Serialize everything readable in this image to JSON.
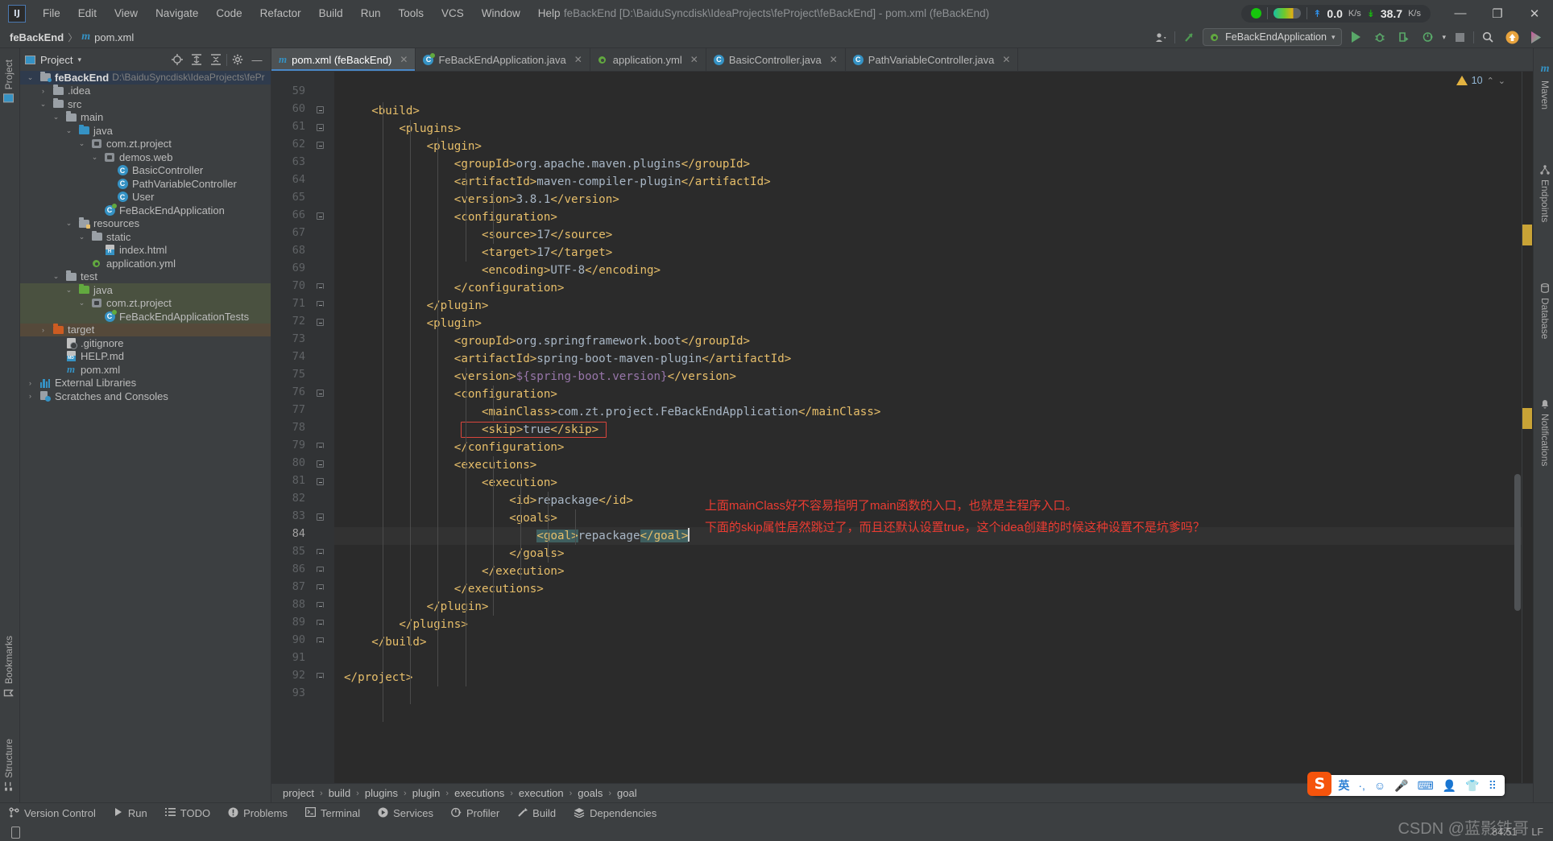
{
  "window": {
    "title": "feBackEnd [D:\\BaiduSyncdisk\\IdeaProjects\\feProject\\feBackEnd] - pom.xml (feBackEnd)",
    "logo": "IJ",
    "minimize": "—",
    "maximize": "❐",
    "close": "✕"
  },
  "menubar": {
    "items": [
      "File",
      "Edit",
      "View",
      "Navigate",
      "Code",
      "Refactor",
      "Build",
      "Run",
      "Tools",
      "VCS",
      "Window",
      "Help"
    ]
  },
  "network": {
    "upload_value": "0.0",
    "upload_unit": "K/s",
    "download_value": "38.7",
    "download_unit": "K/s",
    "up_arrow": "↟",
    "down_arrow": "↡"
  },
  "navbar": {
    "project": "feBackEnd",
    "separator": "〉",
    "file": "pom.xml",
    "run_configuration": "FeBackEndApplication",
    "chevron": "▾"
  },
  "project_panel": {
    "title": "Project",
    "tree": [
      {
        "depth": 0,
        "arrow": "⌄",
        "icon": "module-folder",
        "label": "feBackEnd",
        "bold": true,
        "path": "D:\\BaiduSyncdisk\\IdeaProjects\\fePr",
        "state": "root-selected"
      },
      {
        "depth": 1,
        "arrow": "›",
        "icon": "folder",
        "label": ".idea"
      },
      {
        "depth": 1,
        "arrow": "⌄",
        "icon": "folder",
        "label": "src"
      },
      {
        "depth": 2,
        "arrow": "⌄",
        "icon": "folder",
        "label": "main"
      },
      {
        "depth": 3,
        "arrow": "⌄",
        "icon": "folder-blue",
        "label": "java"
      },
      {
        "depth": 4,
        "arrow": "⌄",
        "icon": "package",
        "label": "com.zt.project"
      },
      {
        "depth": 5,
        "arrow": "⌄",
        "icon": "package",
        "label": "demos.web"
      },
      {
        "depth": 6,
        "arrow": "",
        "icon": "class",
        "label": "BasicController"
      },
      {
        "depth": 6,
        "arrow": "",
        "icon": "class",
        "label": "PathVariableController"
      },
      {
        "depth": 6,
        "arrow": "",
        "icon": "class",
        "label": "User"
      },
      {
        "depth": 5,
        "arrow": "",
        "icon": "spring-class",
        "label": "FeBackEndApplication"
      },
      {
        "depth": 3,
        "arrow": "⌄",
        "icon": "folder-res",
        "label": "resources"
      },
      {
        "depth": 4,
        "arrow": "⌄",
        "icon": "folder",
        "label": "static"
      },
      {
        "depth": 5,
        "arrow": "",
        "icon": "html",
        "label": "index.html"
      },
      {
        "depth": 4,
        "arrow": "",
        "icon": "yml",
        "label": "application.yml"
      },
      {
        "depth": 2,
        "arrow": "⌄",
        "icon": "folder",
        "label": "test"
      },
      {
        "depth": 3,
        "arrow": "⌄",
        "icon": "folder-green",
        "label": "java",
        "state": "green"
      },
      {
        "depth": 4,
        "arrow": "⌄",
        "icon": "package",
        "label": "com.zt.project",
        "state": "green"
      },
      {
        "depth": 5,
        "arrow": "",
        "icon": "spring-class",
        "label": "FeBackEndApplicationTests",
        "state": "green"
      },
      {
        "depth": 1,
        "arrow": "›",
        "icon": "folder-orange",
        "label": "target",
        "state": "brown"
      },
      {
        "depth": 2,
        "arrow": "",
        "icon": "gitignore",
        "label": ".gitignore"
      },
      {
        "depth": 2,
        "arrow": "",
        "icon": "markdown",
        "label": "HELP.md"
      },
      {
        "depth": 2,
        "arrow": "",
        "icon": "maven",
        "label": "pom.xml"
      },
      {
        "depth": 0,
        "arrow": "›",
        "icon": "libraries",
        "label": "External Libraries"
      },
      {
        "depth": 0,
        "arrow": "›",
        "icon": "scratches",
        "label": "Scratches and Consoles"
      }
    ]
  },
  "left_strip": {
    "project_label": "Project",
    "bookmarks_label": "Bookmarks",
    "structure_label": "Structure"
  },
  "right_strip": {
    "items": [
      "Maven",
      "Endpoints",
      "Database",
      "Notifications"
    ]
  },
  "tabs": [
    {
      "label": "pom.xml (feBackEnd)",
      "icon": "maven",
      "active": true,
      "close": "✕"
    },
    {
      "label": "FeBackEndApplication.java",
      "icon": "spring-class",
      "active": false,
      "close": "✕"
    },
    {
      "label": "application.yml",
      "icon": "yml",
      "active": false,
      "close": "✕"
    },
    {
      "label": "BasicController.java",
      "icon": "class",
      "active": false,
      "close": "✕"
    },
    {
      "label": "PathVariableController.java",
      "icon": "class",
      "active": false,
      "close": "✕"
    }
  ],
  "inspection": {
    "warning_count": "10",
    "up_chevron": "⌃",
    "down_chevron": "⌄"
  },
  "editor": {
    "first_line_number": 59,
    "cursor_position": "84:51",
    "line_separator": "LF",
    "lines": [
      {
        "n": 59,
        "indent": 0,
        "text": ""
      },
      {
        "n": 60,
        "indent": 1,
        "fold": true,
        "text": "<build>"
      },
      {
        "n": 61,
        "indent": 2,
        "fold": true,
        "text": "<plugins>"
      },
      {
        "n": 62,
        "indent": 3,
        "fold": true,
        "text": "<plugin>"
      },
      {
        "n": 63,
        "indent": 4,
        "text": "<groupId>org.apache.maven.plugins</groupId>"
      },
      {
        "n": 64,
        "indent": 4,
        "text": "<artifactId>maven-compiler-plugin</artifactId>"
      },
      {
        "n": 65,
        "indent": 4,
        "text": "<version>3.8.1</version>"
      },
      {
        "n": 66,
        "indent": 4,
        "fold": true,
        "text": "<configuration>"
      },
      {
        "n": 67,
        "indent": 5,
        "text": "<source>17</source>"
      },
      {
        "n": 68,
        "indent": 5,
        "text": "<target>17</target>"
      },
      {
        "n": 69,
        "indent": 5,
        "text": "<encoding>UTF-8</encoding>"
      },
      {
        "n": 70,
        "indent": 4,
        "foldend": true,
        "text": "</configuration>"
      },
      {
        "n": 71,
        "indent": 3,
        "foldend": true,
        "text": "</plugin>"
      },
      {
        "n": 72,
        "indent": 3,
        "fold": true,
        "text": "<plugin>"
      },
      {
        "n": 73,
        "indent": 4,
        "text": "<groupId>org.springframework.boot</groupId>"
      },
      {
        "n": 74,
        "indent": 4,
        "text": "<artifactId>spring-boot-maven-plugin</artifactId>"
      },
      {
        "n": 75,
        "indent": 4,
        "text": "<version>${spring-boot.version}</version>"
      },
      {
        "n": 76,
        "indent": 4,
        "fold": true,
        "text": "<configuration>"
      },
      {
        "n": 77,
        "indent": 5,
        "text": "<mainClass>com.zt.project.FeBackEndApplication</mainClass>"
      },
      {
        "n": 78,
        "indent": 5,
        "text": "<skip>true</skip>",
        "boxed": true
      },
      {
        "n": 79,
        "indent": 4,
        "foldend": true,
        "text": "</configuration>"
      },
      {
        "n": 80,
        "indent": 4,
        "fold": true,
        "text": "<executions>"
      },
      {
        "n": 81,
        "indent": 5,
        "fold": true,
        "text": "<execution>"
      },
      {
        "n": 82,
        "indent": 6,
        "text": "<id>repackage</id>"
      },
      {
        "n": 83,
        "indent": 6,
        "fold": true,
        "text": "<goals>"
      },
      {
        "n": 84,
        "indent": 7,
        "text": "<goal>repackage</goal>",
        "current": true,
        "selected": true
      },
      {
        "n": 85,
        "indent": 6,
        "foldend": true,
        "text": "</goals>"
      },
      {
        "n": 86,
        "indent": 5,
        "foldend": true,
        "text": "</execution>"
      },
      {
        "n": 87,
        "indent": 4,
        "foldend": true,
        "text": "</executions>"
      },
      {
        "n": 88,
        "indent": 3,
        "foldend": true,
        "text": "</plugin>"
      },
      {
        "n": 89,
        "indent": 2,
        "foldend": true,
        "text": "</plugins>"
      },
      {
        "n": 90,
        "indent": 1,
        "foldend": true,
        "text": "</build>"
      },
      {
        "n": 91,
        "indent": 0,
        "text": ""
      },
      {
        "n": 92,
        "indent": 0,
        "foldend": true,
        "text": "</project>"
      },
      {
        "n": 93,
        "indent": 0,
        "text": ""
      }
    ],
    "annotation_line1": "上面mainClass好不容易指明了main函数的入口，也就是主程序入口。",
    "annotation_line2": "下面的skip属性居然跳过了，而且还默认设置true，这个idea创建的时候这种设置不是坑爹吗？"
  },
  "breadcrumb": {
    "items": [
      "project",
      "build",
      "plugins",
      "plugin",
      "executions",
      "execution",
      "goals",
      "goal"
    ],
    "separator": "›"
  },
  "bottom_tools": [
    {
      "label": "Version Control",
      "icon": "branch-icon"
    },
    {
      "label": "Run",
      "icon": "play-icon"
    },
    {
      "label": "TODO",
      "icon": "list-icon"
    },
    {
      "label": "Problems",
      "icon": "error-icon"
    },
    {
      "label": "Terminal",
      "icon": "terminal-icon"
    },
    {
      "label": "Services",
      "icon": "services-icon"
    },
    {
      "label": "Profiler",
      "icon": "profiler-icon"
    },
    {
      "label": "Build",
      "icon": "hammer-icon"
    },
    {
      "label": "Dependencies",
      "icon": "layers-icon"
    }
  ],
  "status": {
    "position": "84:51",
    "line_sep": "LF"
  },
  "watermark": "CSDN @蓝影铁哥",
  "ime": {
    "logo": "S",
    "mode": "英",
    "items": [
      "·,",
      "☺",
      "🎤",
      "⌨",
      "👤",
      "👕",
      "⠿"
    ]
  },
  "colors": {
    "accent": "#3592c4",
    "run_green": "#59a869",
    "warning": "#e3b341",
    "annotation_red": "#eb3c32",
    "tag": "#e8bf6a",
    "text": "#a9b7c6",
    "editor_bg": "#2b2b2b",
    "panel_bg": "#3c3f41"
  }
}
